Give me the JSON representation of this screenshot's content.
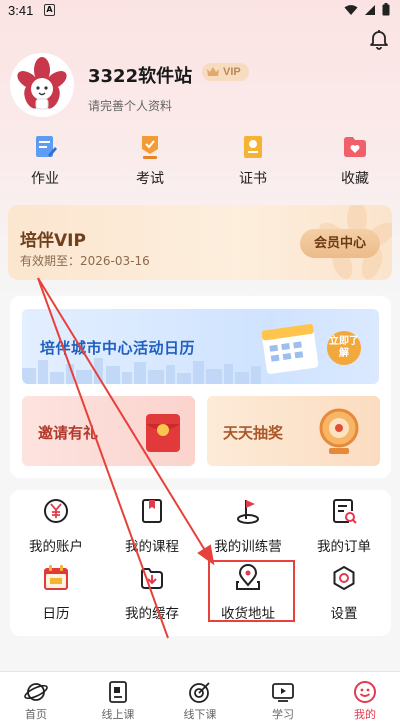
{
  "status_bar": {
    "time": "3:41",
    "sim_label": "A"
  },
  "profile": {
    "name": "3322软件站",
    "vip_label": "VIP",
    "hint": "请完善个人资料"
  },
  "quick_actions": [
    {
      "label": "作业",
      "icon": "homework-icon"
    },
    {
      "label": "考试",
      "icon": "exam-icon"
    },
    {
      "label": "证书",
      "icon": "certificate-icon"
    },
    {
      "label": "收藏",
      "icon": "favorite-icon"
    }
  ],
  "vip_card": {
    "title": "培伴VIP",
    "expiry": "有效期至：2026-03-16",
    "button_label": "会员中心"
  },
  "promotions": {
    "banner_text": "培伴城市中心活动日历",
    "banner_badge": "立即了解",
    "invite_label": "邀请有礼",
    "lottery_label": "天天抽奖"
  },
  "menu": [
    {
      "label": "我的账户",
      "icon": "yen-account-icon"
    },
    {
      "label": "我的课程",
      "icon": "course-book-icon"
    },
    {
      "label": "我的训练营",
      "icon": "camp-flag-icon"
    },
    {
      "label": "我的订单",
      "icon": "order-icon"
    },
    {
      "label": "日历",
      "icon": "calendar-icon"
    },
    {
      "label": "我的缓存",
      "icon": "download-cache-icon"
    },
    {
      "label": "收货地址",
      "icon": "location-icon"
    },
    {
      "label": "设置",
      "icon": "settings-icon"
    }
  ],
  "tabs": [
    {
      "label": "首页",
      "icon": "home-planet-icon",
      "active": false
    },
    {
      "label": "线上课",
      "icon": "online-course-icon",
      "active": false
    },
    {
      "label": "线下课",
      "icon": "offline-target-icon",
      "active": false
    },
    {
      "label": "学习",
      "icon": "study-play-icon",
      "active": false
    },
    {
      "label": "我的",
      "icon": "me-smile-icon",
      "active": true
    }
  ],
  "colors": {
    "accent_red": "#e23a4e",
    "annotation_red": "#e8403a",
    "vip_brown": "#6e3f1b",
    "banner_blue": "#1f5fbf"
  }
}
